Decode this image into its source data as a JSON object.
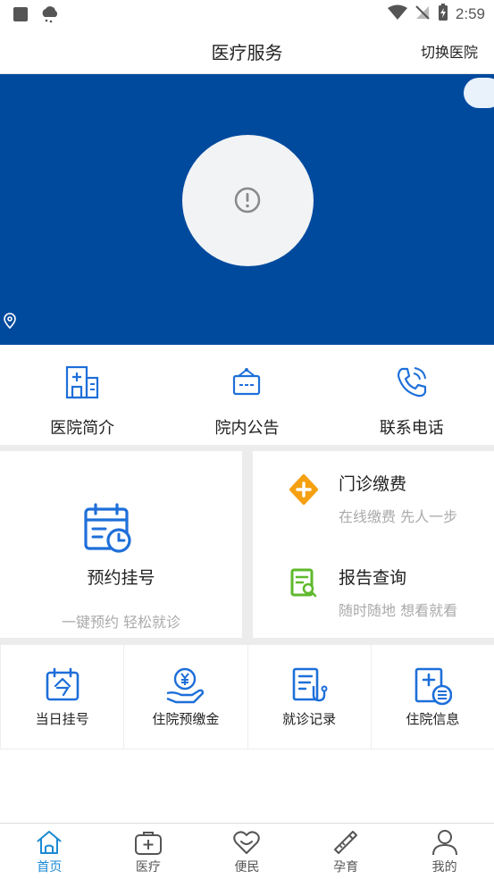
{
  "status_bar": {
    "time": "2:59"
  },
  "header": {
    "title": "医疗服务",
    "switch_label": "切换医院"
  },
  "quick_links": [
    {
      "label": "医院简介"
    },
    {
      "label": "院内公告"
    },
    {
      "label": "联系电话"
    }
  ],
  "featured": {
    "appointment": {
      "title": "预约挂号",
      "subtitle": "一键预约  轻松就诊"
    },
    "payment": {
      "title": "门诊缴费",
      "subtitle": "在线缴费  先人一步"
    },
    "report": {
      "title": "报告查询",
      "subtitle": "随时随地  想看就看"
    }
  },
  "services": [
    {
      "label": "当日挂号"
    },
    {
      "label": "住院预缴金"
    },
    {
      "label": "就诊记录"
    },
    {
      "label": "住院信息"
    }
  ],
  "tabs": [
    {
      "label": "首页",
      "active": true
    },
    {
      "label": "医疗"
    },
    {
      "label": "便民"
    },
    {
      "label": "孕育"
    },
    {
      "label": "我的"
    }
  ],
  "colors": {
    "banner": "#004a9e",
    "accent": "#1a8ad4",
    "icon_blue": "#1e6fd9",
    "payment_orange": "#f5a011",
    "report_green": "#5fb92c"
  }
}
